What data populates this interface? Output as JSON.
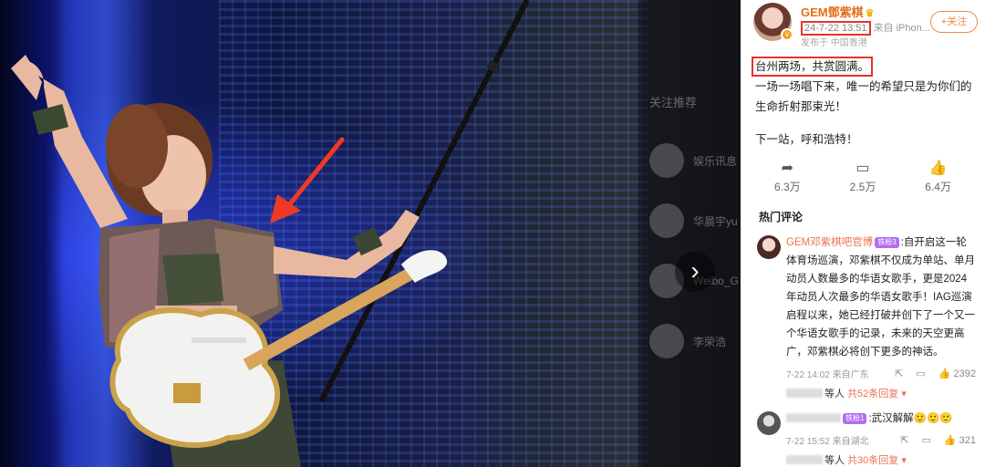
{
  "photo": {
    "next_arrow": "›",
    "recommend": {
      "title": "关注推荐",
      "items": [
        {
          "name": "娱乐讯息"
        },
        {
          "name": "华晨宇yu"
        },
        {
          "name": "Weibo_G"
        },
        {
          "name": "李荣浩"
        }
      ]
    }
  },
  "post": {
    "author": "GEM鄧紫棋",
    "crown": "♛",
    "time": "24-7-22 13:51",
    "source": "来自 iPhon...",
    "location": "发布于 中国香港",
    "follow_label": "+关注",
    "lines": [
      "台州两场，共赏圆满。",
      "一场一场唱下来，唯一的希望只是为你们的生命折射那束光！",
      "下一站，呼和浩特！"
    ],
    "actions": [
      {
        "icon": "share-icon",
        "glyph": "➦",
        "count": "6.3万"
      },
      {
        "icon": "comment-icon",
        "glyph": "▭",
        "count": "2.5万"
      },
      {
        "icon": "like-icon",
        "glyph": "👍",
        "count": "6.4万"
      }
    ]
  },
  "hot_comments": {
    "title": "热门评论",
    "items": [
      {
        "author": "GEM邓紫棋吧官博",
        "badge": "铁粉3",
        "text": ":自开启这一轮体育场巡演，邓紫棋不仅成为单站、单月动员人数最多的华语女歌手，更是2024年动员人次最多的华语女歌手！IAG巡演启程以来，她已经打破并创下了一个又一个华语女歌手的记录，未来的天空更高广，邓紫棋必将创下更多的神话。",
        "time": "7-22 14:02 来自广东",
        "like_count": "2392",
        "reply_suffix": "等人",
        "reply_more": "共52条回复 ▾"
      },
      {
        "author": "",
        "badge": "铁粉1",
        "text": ":武汉解解🙂🙂🙂",
        "time": "7-22 15:52 来自湖北",
        "like_count": "321",
        "reply_suffix": "等人",
        "reply_more": "共30条回复 ▾"
      }
    ]
  },
  "colors": {
    "highlight_box": "#e8322b",
    "brand_orange": "#eb7350"
  }
}
